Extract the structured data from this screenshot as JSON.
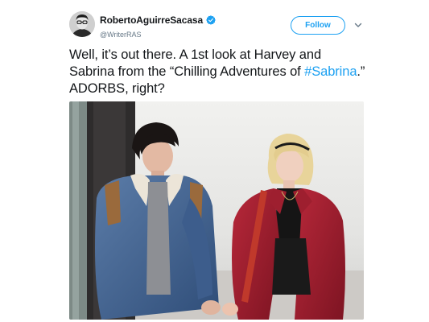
{
  "author": {
    "display_name": "RobertoAguirreSacasa",
    "handle": "@WriterRAS",
    "verified": true,
    "avatar_icon": "profile-photo"
  },
  "actions": {
    "follow_label": "Follow",
    "more_icon": "chevron-down-icon"
  },
  "tweet": {
    "text_before": "Well, it’s out there. A 1st look at Harvey and Sabrina from the “Chilling Adventures of ",
    "hashtag": "#Sabrina",
    "text_after": ".” ADORBS, right?"
  },
  "media": {
    "type": "photo"
  },
  "colors": {
    "accent": "#1da1f2",
    "text": "#14171a",
    "muted": "#657786"
  }
}
